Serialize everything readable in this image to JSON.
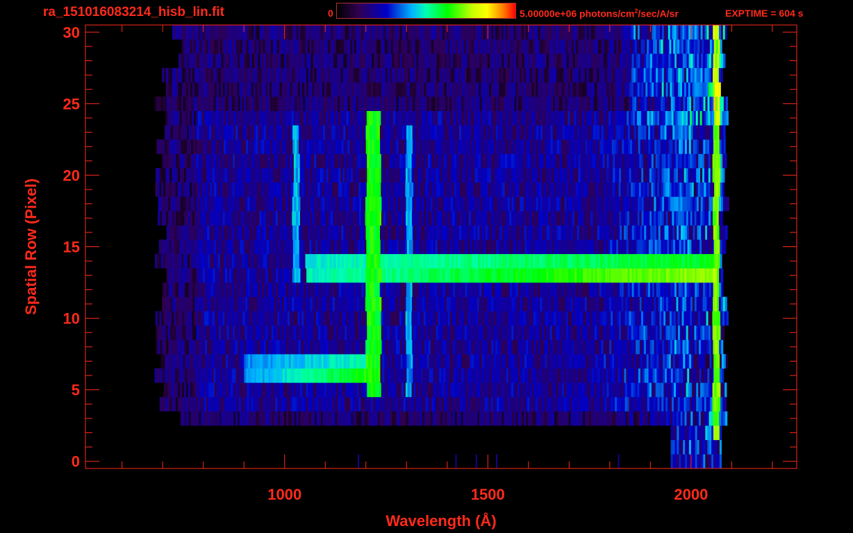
{
  "header": {
    "filename": "ra_151016083214_hisb_lin.fit",
    "colorbar_min": "0",
    "colorbar_max": "5.00000e+06",
    "colorbar_units_prefix": "photons/cm",
    "colorbar_units_sup": "2",
    "colorbar_units_suffix": "/sec/A/sr",
    "exptime": "EXPTIME = 604 s"
  },
  "chart_data": {
    "type": "heatmap",
    "title": "ra_151016083214_hisb_lin.fit",
    "xlabel": "Wavelength (Å)",
    "ylabel": "Spatial Row (Pixel)",
    "xlim": [
      510,
      2260
    ],
    "ylim": [
      -0.5,
      30.5
    ],
    "x_ticks": [
      1000,
      1500,
      2000
    ],
    "y_ticks": [
      0,
      5,
      10,
      15,
      20,
      25,
      30
    ],
    "colorbar": {
      "min": 0,
      "max": 5000000,
      "units": "photons/cm^2/sec/A/sr",
      "colormap": "rainbow"
    },
    "exptime_s": 604,
    "rows": 31,
    "data_extent": {
      "wavelength_min": 680,
      "wavelength_max": 2090
    },
    "features": [
      {
        "name": "Lyman-alpha",
        "wavelength": 1216,
        "rows": [
          5,
          24
        ],
        "level": 0.62
      },
      {
        "name": "emission line",
        "wavelength": 1026,
        "rows": [
          13,
          23
        ],
        "level": 0.42
      },
      {
        "name": "emission line",
        "wavelength": 1304,
        "rows": [
          5,
          23
        ],
        "level": 0.4
      },
      {
        "name": "continuum band",
        "wavelength_range": [
          1050,
          2060
        ],
        "rows": [
          13,
          14
        ],
        "level": 0.55
      },
      {
        "name": "continuum band",
        "wavelength_range": [
          900,
          1200
        ],
        "rows": [
          6,
          7
        ],
        "level": 0.45
      },
      {
        "name": "red-end edge",
        "wavelength": 2060,
        "rows": [
          2,
          30
        ],
        "level": 0.7
      }
    ],
    "colors": {
      "axis": "#ff2a1a",
      "background": "#000000"
    }
  }
}
